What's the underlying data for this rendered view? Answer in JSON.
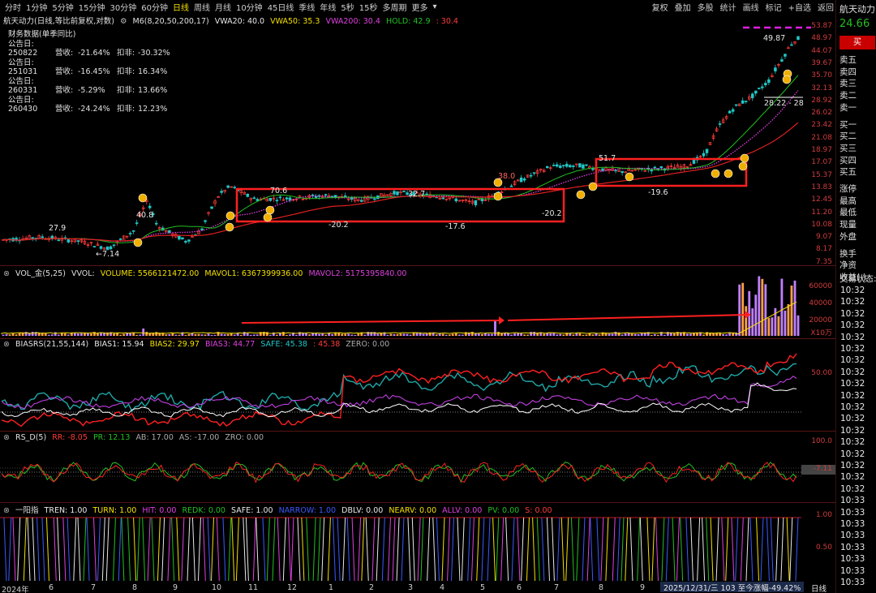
{
  "toolbar": {
    "timeframes": [
      "分时",
      "1分钟",
      "5分钟",
      "15分钟",
      "30分钟",
      "60分钟",
      "日线",
      "周线",
      "月线",
      "10分钟",
      "45日线",
      "季线",
      "年线",
      "5秒",
      "15秒",
      "多周期",
      "更多"
    ],
    "active_index": 6,
    "right_buttons": [
      "复权",
      "叠加",
      "多股",
      "统计",
      "画线",
      "标记",
      "+自选",
      "返回"
    ],
    "more_caret": "▾"
  },
  "stock": {
    "name": "航天动力",
    "price": "24.66",
    "buy_label": "买",
    "dash": "-"
  },
  "main_legend": {
    "title": "航天动力(日线,等比前复权,对数)",
    "ma": "M6(8,20,50,200,17)",
    "vwa20": "VWA20: 40.0",
    "vwa50": "VWA50: 35.3",
    "vwa200": "VWA200: 30.4",
    "hold": "HOLD: 42.9",
    "hold2": ": 30.4"
  },
  "financials": {
    "title": "财务数据(单季同比)",
    "rows": [
      {
        "date": "公告日: 250822",
        "rev_label": "营收:",
        "rev": "-21.64%",
        "np_label": "扣非:",
        "np": "-30.32%"
      },
      {
        "date": "公告日: 251031",
        "rev_label": "营收:",
        "rev": "-16.45%",
        "np_label": "扣非:",
        "np": "16.34%"
      },
      {
        "date": "公告日: 260331",
        "rev_label": "营收:",
        "rev": "-5.29%",
        "np_label": "扣非:",
        "np": "13.66%"
      },
      {
        "date": "公告日: 260430",
        "rev_label": "营收:",
        "rev": "-24.24%",
        "np_label": "扣非:",
        "np": "12.23%"
      }
    ]
  },
  "price_axis": [
    "53.87",
    "48.97",
    "44.07",
    "39.67",
    "35.70",
    "32.13",
    "28.92",
    "26.02",
    "23.42",
    "21.08",
    "18.97",
    "17.07",
    "15.37",
    "13.83",
    "12.45",
    "11.20",
    "10.08",
    "9.07",
    "8.17",
    "7.35"
  ],
  "price_annotations": [
    "27.9",
    "40.8",
    "←7.14",
    "70.6",
    "32.7",
    "38.0",
    "-20.2",
    "-17.6",
    "-20.2",
    "51.7",
    "-19.6",
    "49.87",
    "28.22 - 28"
  ],
  "vol_legend": {
    "name": "VOL_金(5,25)",
    "vvol": "VVOL:",
    "volume": "VOLUME: 5566121472.00",
    "mavol1": "MAVOL1: 6367399936.00",
    "mavol2": "MAVOL2: 5175395840.00"
  },
  "vol_axis": [
    "60000",
    "40000",
    "20000",
    "X10万"
  ],
  "bias_legend": {
    "name": "BIASRS(21,55,144)",
    "b1": "BIAS1: 15.94",
    "b2": "BIAS2: 29.97",
    "b3": "BIAS3: 44.77",
    "safe": "SAFE: 45.38",
    "s2": ": 45.38",
    "zero": "ZERO: 0.00"
  },
  "bias_axis": [
    "50.00"
  ],
  "rs_legend": {
    "name": "RS_D(5)",
    "rr": "RR: -8.05",
    "pr": "PR: 12.13",
    "ab": "AB: 17.00",
    "as": "AS: -17.00",
    "zro": "ZRO: 0.00"
  },
  "rs_axis": [
    "100.0",
    "-7.11"
  ],
  "yy_legend": {
    "name": "一阳指",
    "tren": "TREN: 1.00",
    "turn": "TURN: 1.00",
    "hit": "HIT: 0.00",
    "redk": "REDK: 0.00",
    "safe": "SAFE: 1.00",
    "narrow": "NARROW: 1.00",
    "dblv": "DBLV: 0.00",
    "nearv": "NEARV: 0.00",
    "allv": "ALLV: 0.00",
    "pv": "PV: 0.00",
    "s": "S: 0.00"
  },
  "yy_axis": [
    "1.00",
    "0.50"
  ],
  "x_axis": [
    "2024年",
    "6",
    "7",
    "8",
    "9",
    "10",
    "11",
    "12",
    "1",
    "2",
    "3",
    "4",
    "5",
    "6",
    "7",
    "8",
    "9"
  ],
  "status_bar": "2025/12/31/三 103 至今涨幅-49.42%",
  "period_label": "日线",
  "order_book": [
    "卖五",
    "卖四",
    "卖三",
    "卖二",
    "卖一",
    "买一",
    "买二",
    "买三",
    "买四",
    "买五",
    "涨停",
    "最高",
    "最低",
    "现量",
    "外盘",
    "换手",
    "净资",
    "收益(-)"
  ],
  "trade_status": "交易状态:",
  "times": [
    "10:32",
    "10:32",
    "10:32",
    "10:32",
    "10:32",
    "10:32",
    "10:32",
    "10:32",
    "10:32",
    "10:32",
    "10:32",
    "10:32",
    "10:32",
    "10:32",
    "10:32",
    "10:32",
    "10:32",
    "10:32",
    "10:33",
    "10:33",
    "10:33",
    "10:33",
    "10:33",
    "10:33",
    "10:33",
    "10:33"
  ],
  "colors": {
    "up": "#ff3b3b",
    "down": "#22c7c7",
    "yellow": "#f5e000",
    "magenta": "#e040e0",
    "green": "#22c022",
    "frame": "#ff2020"
  }
}
